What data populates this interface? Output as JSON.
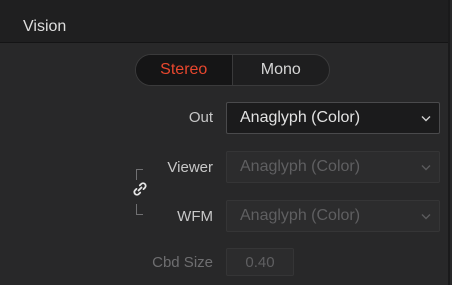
{
  "panel": {
    "title": "Vision"
  },
  "mode_toggle": {
    "options": [
      "Stereo",
      "Mono"
    ],
    "selected": "Stereo"
  },
  "out": {
    "label": "Out",
    "value": "Anaglyph (Color)",
    "enabled": true
  },
  "viewer": {
    "label": "Viewer",
    "value": "Anaglyph (Color)",
    "enabled": false
  },
  "wfm": {
    "label": "WFM",
    "value": "Anaglyph (Color)",
    "enabled": false
  },
  "cbd_size": {
    "label": "Cbd Size",
    "value": "0.40",
    "enabled": false
  },
  "colors": {
    "accent_active": "#e8472e",
    "panel_bg": "#282829",
    "header_bg": "#1f1f20"
  },
  "icons": {
    "link": "link-icon",
    "dropdown": "chevron-down-icon"
  }
}
